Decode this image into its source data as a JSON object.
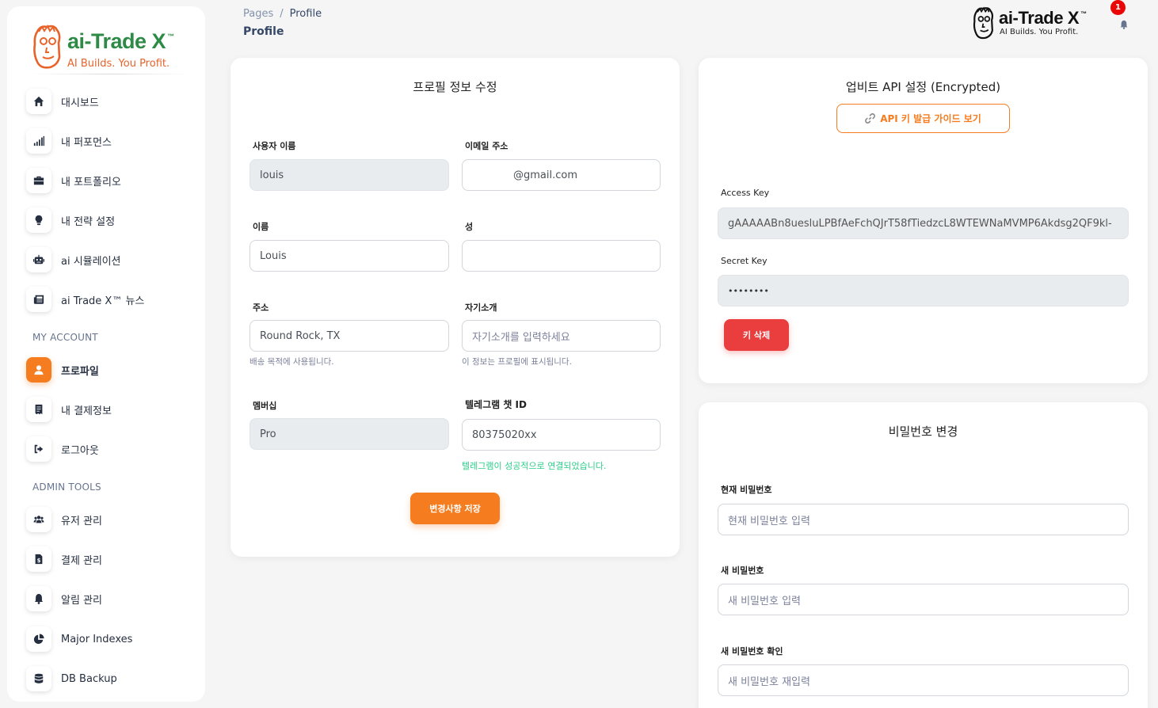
{
  "sidebar": {
    "brand": {
      "name": "ai-Trade X",
      "tm": "™",
      "tagline": "AI Builds. You Profit."
    },
    "items": [
      {
        "label": "대시보드",
        "icon": "home-icon"
      },
      {
        "label": "내 퍼포먼스",
        "icon": "signal-bars-icon"
      },
      {
        "label": "내 포트폴리오",
        "icon": "briefcase-icon"
      },
      {
        "label": "내 전략 설정",
        "icon": "lightbulb-icon"
      },
      {
        "label": "ai 시뮬레이션",
        "icon": "robot-icon"
      },
      {
        "label": "ai Trade X™ 뉴스",
        "icon": "newspaper-icon"
      }
    ],
    "account_section": "MY ACCOUNT",
    "account_items": [
      {
        "label": "프로파일",
        "icon": "user-icon",
        "active": true
      },
      {
        "label": "내 결제정보",
        "icon": "receipt-icon"
      },
      {
        "label": "로그아웃",
        "icon": "sign-out-icon"
      }
    ],
    "admin_section": "ADMIN TOOLS",
    "admin_items": [
      {
        "label": "유저 관리",
        "icon": "users-icon"
      },
      {
        "label": "결제 관리",
        "icon": "invoice-dollar-icon"
      },
      {
        "label": "알림 관리",
        "icon": "bell-icon"
      },
      {
        "label": "Major Indexes",
        "icon": "pie-chart-icon"
      },
      {
        "label": "DB Backup",
        "icon": "database-icon"
      }
    ]
  },
  "header": {
    "breadcrumb_root": "Pages",
    "breadcrumb_sep": "/",
    "breadcrumb_current": "Profile",
    "title": "Profile",
    "brand_name": "ai-Trade X",
    "brand_tm": "™",
    "brand_tagline": "AI Builds. You Profit.",
    "notification_count": "1"
  },
  "profile_form": {
    "title": "프로필 정보 수정",
    "username_label": "사용자 이름",
    "username_value": "louis",
    "email_label": "이메일 주소",
    "email_value": "@gmail.com",
    "firstname_label": "이름",
    "firstname_value": "Louis",
    "lastname_label": "성",
    "lastname_value": "",
    "address_label": "주소",
    "address_value": "Round Rock, TX",
    "address_hint": "배송 목적에 사용됩니다.",
    "bio_label": "자기소개",
    "bio_placeholder": "자기소개를 입력하세요",
    "bio_hint": "이 정보는 프로필에 표시됩니다.",
    "membership_label": "멤버십",
    "membership_value": "Pro",
    "telegram_label": "텔레그램 챗 ID",
    "telegram_value": "80375020xx",
    "telegram_status": "텔레그램이 성공적으로 연결되었습니다.",
    "save_button": "변경사항 저장"
  },
  "api_settings": {
    "title": "업비트 API 설정 (Encrypted)",
    "guide_button": "API 키 발급 가이드 보기",
    "access_key_label": "Access Key",
    "access_key_value": "gAAAAABn8uesluLPBfAeFchQJrT58fTiedzcL8WTEWNaMVMP6Akdsg2QF9kl-",
    "secret_key_label": "Secret Key",
    "secret_key_value": "••••••••",
    "delete_button": "키 삭제"
  },
  "password_change": {
    "title": "비밀번호 변경",
    "current_label": "현재 비밀번호",
    "current_placeholder": "현재 비밀번호 입력",
    "new_label": "새 비밀번호",
    "new_placeholder": "새 비밀번호 입력",
    "confirm_label": "새 비밀번호 확인",
    "confirm_placeholder": "새 비밀번호 재입력"
  },
  "colors": {
    "accent": "#f57c1f",
    "danger": "#ea3d3d",
    "success": "#2dce89",
    "brand_green": "#2e8b47"
  }
}
